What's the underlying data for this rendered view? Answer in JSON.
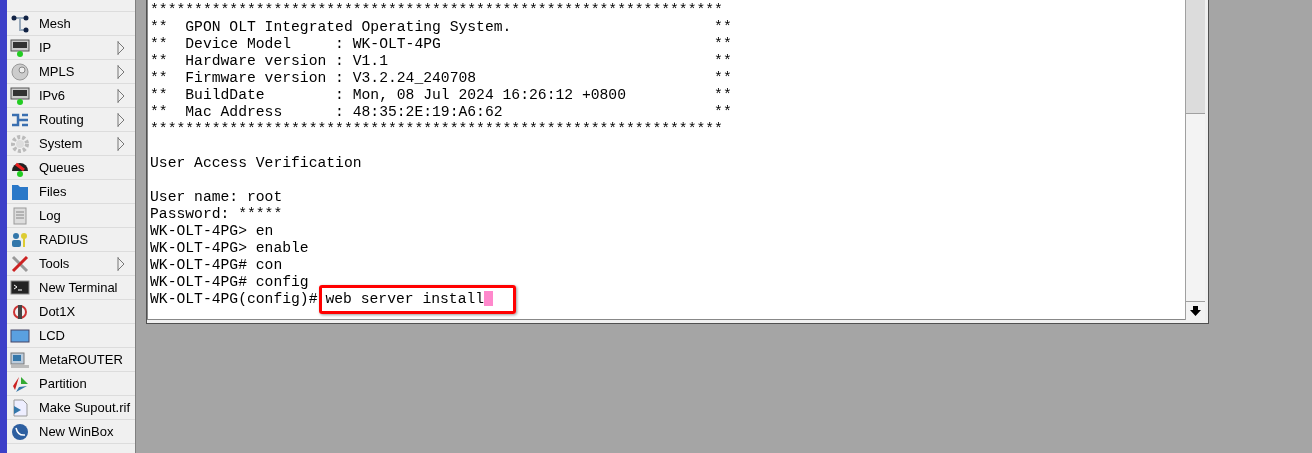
{
  "sidebar": {
    "items": [
      {
        "label": "Mesh",
        "submenu": false
      },
      {
        "label": "IP",
        "submenu": true
      },
      {
        "label": "MPLS",
        "submenu": true
      },
      {
        "label": "IPv6",
        "submenu": true
      },
      {
        "label": "Routing",
        "submenu": true
      },
      {
        "label": "System",
        "submenu": true
      },
      {
        "label": "Queues",
        "submenu": false
      },
      {
        "label": "Files",
        "submenu": false
      },
      {
        "label": "Log",
        "submenu": false
      },
      {
        "label": "RADIUS",
        "submenu": false
      },
      {
        "label": "Tools",
        "submenu": true
      },
      {
        "label": "New Terminal",
        "submenu": false
      },
      {
        "label": "Dot1X",
        "submenu": false
      },
      {
        "label": "LCD",
        "submenu": false
      },
      {
        "label": "MetaROUTER",
        "submenu": false
      },
      {
        "label": "Partition",
        "submenu": false
      },
      {
        "label": "Make Supout.rif",
        "submenu": false
      },
      {
        "label": "New WinBox",
        "submenu": false
      }
    ]
  },
  "terminal": {
    "blocks": [
      [
        "*****************************************************************",
        "**  GPON OLT Integrated Operating System.                       **",
        "**  Device Model     : WK-OLT-4PG                               **",
        "**  Hardware version : V1.1                                     **",
        "**  Firmware version : V3.2.24_240708                           **",
        "**  BuildDate        : Mon, 08 Jul 2024 16:26:12 +0800          **",
        "**  Mac Address      : 48:35:2E:19:A6:62                        **",
        "*****************************************************************"
      ],
      [
        "User Access Verification"
      ],
      [
        "User name: root",
        "Password: *****",
        "WK-OLT-4PG> en",
        "WK-OLT-4PG> enable",
        "WK-OLT-4PG# con",
        "WK-OLT-4PG# config"
      ]
    ],
    "input": {
      "prompt": "WK-OLT-4PG(config)#",
      "command": "web server install",
      "highlighted": true
    }
  }
}
